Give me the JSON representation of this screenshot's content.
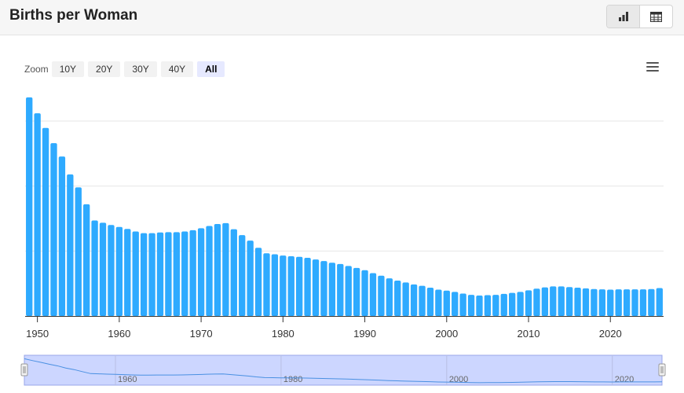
{
  "header": {
    "title": "Births per Woman"
  },
  "view_toggle": [
    {
      "icon": "bar-chart-icon",
      "active": true
    },
    {
      "icon": "table-icon",
      "active": false
    }
  ],
  "zoom": {
    "label": "Zoom",
    "buttons": [
      "10Y",
      "20Y",
      "30Y",
      "40Y",
      "All"
    ],
    "active": "All"
  },
  "colors": {
    "bar": "#2eaaff",
    "navigator_fill": "#ccd6ff",
    "navigator_line": "#4a90e2",
    "grid": "#e6e6e6"
  },
  "chart_data": {
    "type": "bar",
    "title": "Births per Woman",
    "xlabel": "",
    "ylabel": "",
    "ylim": [
      0,
      6.8
    ],
    "x_ticks": [
      1950,
      1960,
      1970,
      1980,
      1990,
      2000,
      2010,
      2020
    ],
    "navigator_ticks": [
      1960,
      1980,
      2000,
      2020
    ],
    "grid": true,
    "legend": "none",
    "x": [
      1949,
      1950,
      1951,
      1952,
      1953,
      1954,
      1955,
      1956,
      1957,
      1958,
      1959,
      1960,
      1961,
      1962,
      1963,
      1964,
      1965,
      1966,
      1967,
      1968,
      1969,
      1970,
      1971,
      1972,
      1973,
      1974,
      1975,
      1976,
      1977,
      1978,
      1979,
      1980,
      1981,
      1982,
      1983,
      1984,
      1985,
      1986,
      1987,
      1988,
      1989,
      1990,
      1991,
      1992,
      1993,
      1994,
      1995,
      1996,
      1997,
      1998,
      1999,
      2000,
      2001,
      2002,
      2003,
      2004,
      2005,
      2006,
      2007,
      2008,
      2009,
      2010,
      2011,
      2012,
      2013,
      2014,
      2015,
      2016,
      2017,
      2018,
      2019,
      2020,
      2021,
      2022,
      2023,
      2024,
      2025,
      2026
    ],
    "values": [
      6.73,
      6.24,
      5.79,
      5.32,
      4.91,
      4.36,
      3.96,
      3.44,
      2.94,
      2.87,
      2.8,
      2.74,
      2.68,
      2.6,
      2.55,
      2.55,
      2.57,
      2.58,
      2.58,
      2.6,
      2.64,
      2.7,
      2.77,
      2.83,
      2.86,
      2.67,
      2.49,
      2.32,
      2.1,
      1.93,
      1.9,
      1.86,
      1.84,
      1.82,
      1.79,
      1.74,
      1.69,
      1.64,
      1.6,
      1.54,
      1.48,
      1.41,
      1.32,
      1.24,
      1.16,
      1.09,
      1.03,
      0.97,
      0.93,
      0.87,
      0.81,
      0.78,
      0.74,
      0.69,
      0.65,
      0.63,
      0.64,
      0.65,
      0.68,
      0.71,
      0.74,
      0.79,
      0.84,
      0.88,
      0.91,
      0.91,
      0.89,
      0.87,
      0.85,
      0.83,
      0.82,
      0.81,
      0.82,
      0.82,
      0.82,
      0.82,
      0.83,
      0.86
    ]
  }
}
